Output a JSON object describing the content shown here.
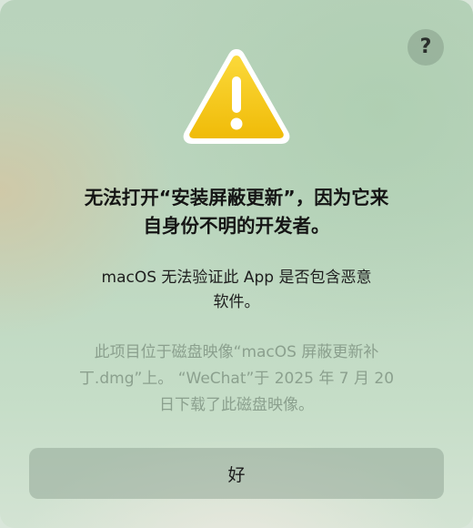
{
  "dialog": {
    "title_line1": "无法打开“安装屏蔽更新”，因为它来",
    "title_line2": "自身份不明的开发者。",
    "message_line1": "macOS 无法验证此 App 是否包含恶意",
    "message_line2": "软件。",
    "detail_line1": "此项目位于磁盘映像“macOS 屏蔽更新补",
    "detail_line2": "丁.dmg”上。 “WeChat”于 2025 年 7 月 20",
    "detail_line3": "日下载了此磁盘映像。",
    "help_label": "?",
    "ok_label": "好"
  },
  "icons": {
    "warning": "warning-triangle-icon",
    "help": "question-mark-icon"
  },
  "colors": {
    "warning_fill": "#f2c40d",
    "background": "#bcd6bf",
    "detail_text": "#8ba08e"
  }
}
